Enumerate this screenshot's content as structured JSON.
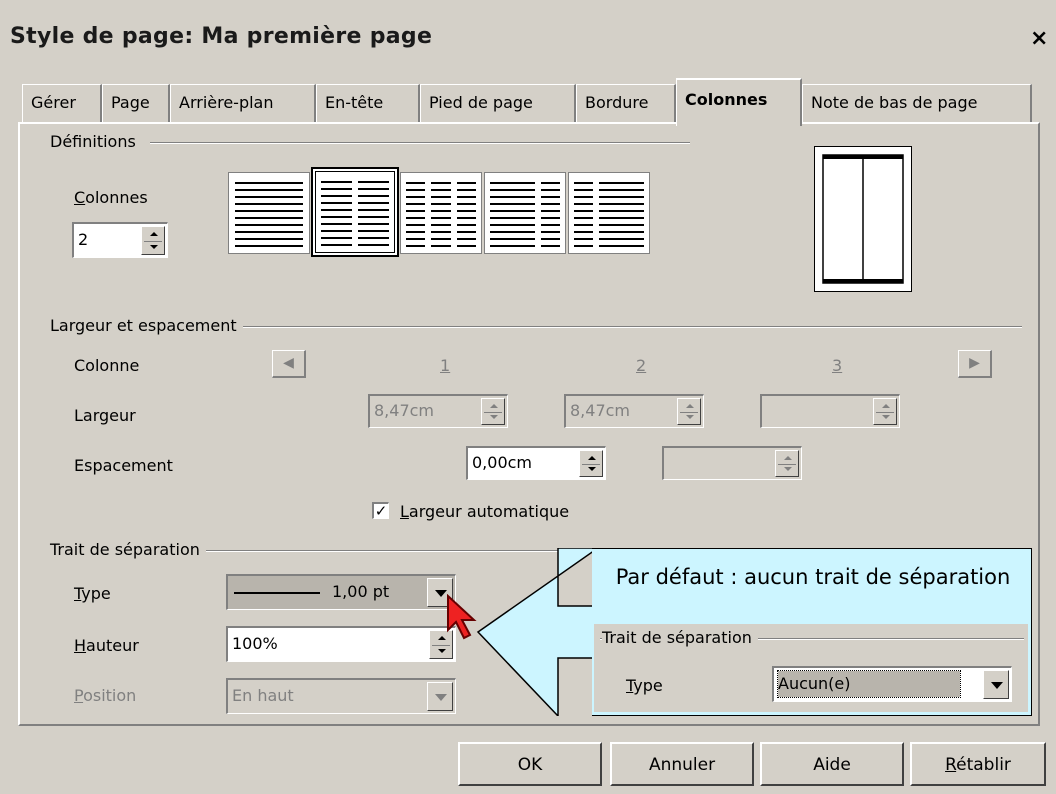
{
  "window": {
    "title": "Style de page: Ma première page",
    "close_glyph": "×"
  },
  "tabs": [
    {
      "label": "Gérer"
    },
    {
      "label": "Page"
    },
    {
      "label": "Arrière-plan"
    },
    {
      "label": "En-tête"
    },
    {
      "label": "Pied de page"
    },
    {
      "label": "Bordure"
    },
    {
      "label": "Colonnes",
      "active": true
    },
    {
      "label": "Note de bas de page"
    }
  ],
  "definitions": {
    "group_label": "Définitions",
    "columns_label_prefix": "C",
    "columns_label_rest": "olonnes",
    "columns_value": "2",
    "presets": [
      "1 colonne",
      "2 colonnes",
      "3 colonnes",
      "2 colonnes gauche",
      "2 colonnes droite"
    ],
    "selected_preset": 1
  },
  "width_spacing": {
    "group_label": "Largeur et espacement",
    "colonne_label": "Colonne",
    "col_numbers": [
      "1",
      "2",
      "3"
    ],
    "largeur_label": "Largeur",
    "widths": [
      "8,47cm",
      "8,47cm",
      ""
    ],
    "espacement_label": "Espacement",
    "spacings": [
      "0,00cm",
      ""
    ],
    "auto_width_prefix": "L",
    "auto_width_rest": "argeur automatique",
    "auto_width_checked": true
  },
  "separator": {
    "group_label": "Trait de séparation",
    "type_label_prefix": "T",
    "type_label_rest": "ype",
    "type_value": "1,00 pt",
    "height_label_prefix": "H",
    "height_label_rest": "auteur",
    "height_value": "100%",
    "position_label_prefix": "P",
    "position_label_rest": "osition",
    "position_value": "En haut"
  },
  "callout": {
    "text": "Par défaut : aucun trait de séparation",
    "group_label": "Trait de séparation",
    "type_label_prefix": "T",
    "type_label_rest": "ype",
    "type_value": "Aucun(e)"
  },
  "buttons": {
    "ok": "OK",
    "cancel": "Annuler",
    "help": "Aide",
    "reset_prefix": "R",
    "reset_rest": "établir"
  },
  "colors": {
    "callout_bg": "#ccf5ff",
    "window_bg": "#d4d0c8",
    "selection_bg": "#b8b4ac"
  }
}
